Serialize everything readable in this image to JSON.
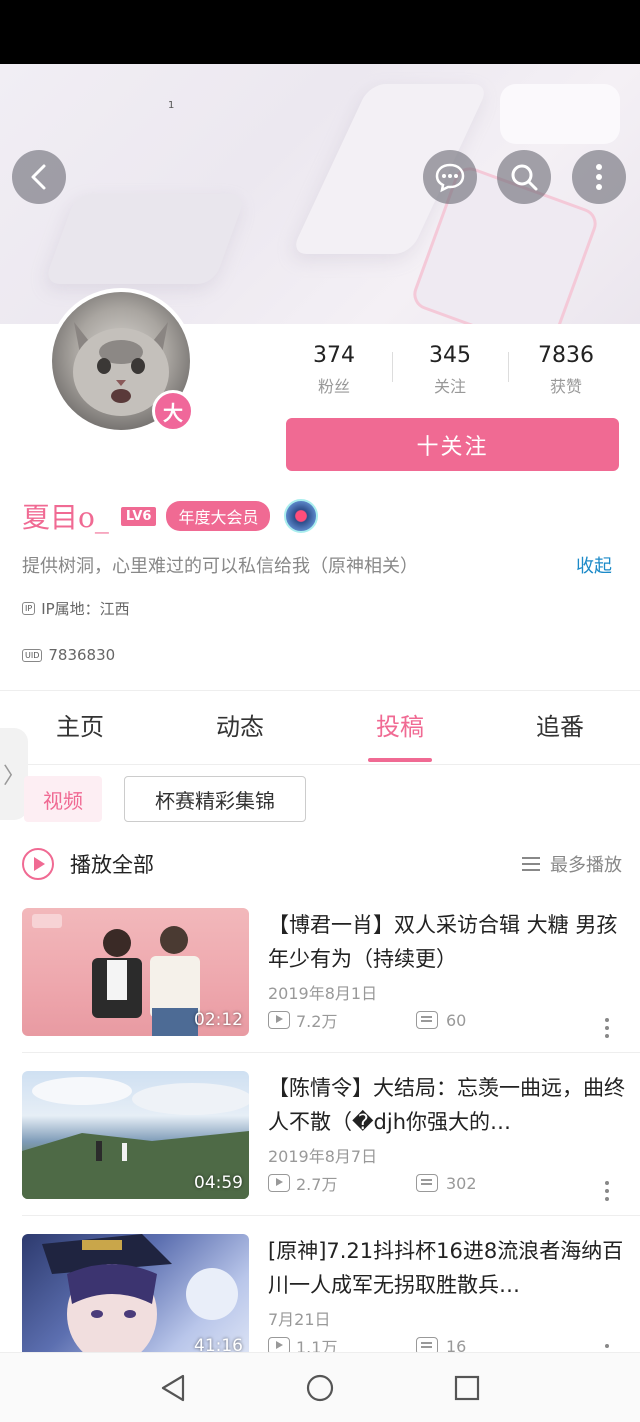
{
  "banner": {
    "corner_text": "1"
  },
  "header_actions": {
    "back_icon": "chevron-left-icon",
    "message_icon": "chat-bubble-icon",
    "search_icon": "search-icon",
    "more_icon": "more-vertical-icon"
  },
  "profile": {
    "avatar_badge": "大",
    "stats": [
      {
        "value": "374",
        "label": "粉丝"
      },
      {
        "value": "345",
        "label": "关注"
      },
      {
        "value": "7836",
        "label": "获赞"
      }
    ],
    "follow_button": "十关注",
    "username": "夏目o_",
    "level_badge": "LV6",
    "vip_badge": "年度大会员",
    "bio": "提供树洞，心里难过的可以私信给我（原神相关）",
    "bio_toggle": "收起",
    "ip_tag": "IP",
    "ip_location": "IP属地：江西",
    "uid_tag": "UID",
    "uid": "7836830"
  },
  "tabs": [
    {
      "label": "主页",
      "active": false
    },
    {
      "label": "动态",
      "active": false
    },
    {
      "label": "投稿",
      "active": true
    },
    {
      "label": "追番",
      "active": false
    }
  ],
  "side_handle": "〉",
  "filters": {
    "video": "视频",
    "collection": "杯赛精彩集锦"
  },
  "play_all": {
    "label": "播放全部",
    "sort_label": "最多播放"
  },
  "videos": [
    {
      "title": "【博君一肖】双人采访合辑 大糖 男孩年少有为（持续更）",
      "date": "2019年8月1日",
      "duration": "02:12",
      "views": "7.2万",
      "danmaku": "60"
    },
    {
      "title": "【陈情令】大结局：忘羡一曲远，曲终人不散（�djh你强大的…",
      "date": "2019年8月7日",
      "duration": "04:59",
      "views": "2.7万",
      "danmaku": "302"
    },
    {
      "title": "[原神]7.21抖抖杯16进8流浪者海纳百川一人成军无拐取胜散兵…",
      "date": "7月21日",
      "duration": "41:16",
      "views": "1.1万",
      "danmaku": "16"
    }
  ],
  "colors": {
    "accent": "#f06a93",
    "link": "#1c8ac8"
  }
}
